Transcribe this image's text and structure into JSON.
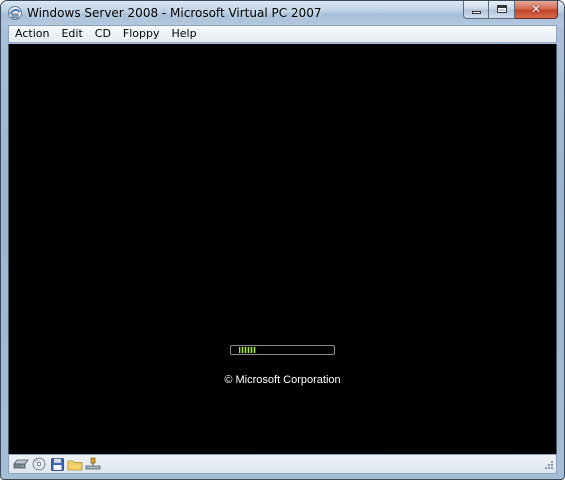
{
  "window": {
    "title": "Windows Server 2008 - Microsoft Virtual PC 2007",
    "app_icon": "virtual-pc-icon",
    "caption_buttons": [
      "minimize-icon",
      "maximize-icon",
      "close-icon"
    ],
    "close_glyph": "✕"
  },
  "menu": {
    "items": [
      {
        "label": "Action"
      },
      {
        "label": "Edit"
      },
      {
        "label": "CD"
      },
      {
        "label": "Floppy"
      },
      {
        "label": "Help"
      }
    ]
  },
  "vm_screen": {
    "background": "#000000",
    "boot_progress_fraction": 0.2,
    "progress_color": "#b6e53a",
    "copyright": "© Microsoft Corporation"
  },
  "status_bar": {
    "icons": [
      "hard-disk-icon",
      "cd-drive-icon",
      "floppy-disk-icon",
      "shared-folder-icon",
      "network-icon"
    ]
  },
  "colors": {
    "titlebar": "#b9cee3",
    "close_button": "#c24329",
    "frame": "#a6bed6"
  }
}
